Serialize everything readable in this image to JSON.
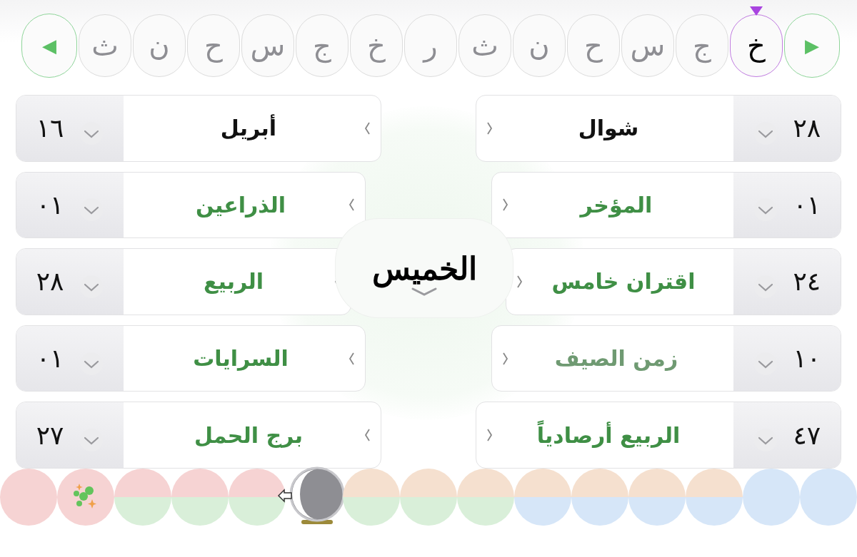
{
  "letter_strip": {
    "next": "▶",
    "previous": "◀",
    "letters": [
      {
        "label": "خ",
        "selected": true
      },
      {
        "label": "ج",
        "selected": false
      },
      {
        "label": "س",
        "selected": false
      },
      {
        "label": "ح",
        "selected": false
      },
      {
        "label": "ن",
        "selected": false
      },
      {
        "label": "ث",
        "selected": false
      },
      {
        "label": "ر",
        "selected": false
      },
      {
        "label": "خ",
        "selected": false
      },
      {
        "label": "ج",
        "selected": false
      },
      {
        "label": "س",
        "selected": false
      },
      {
        "label": "ح",
        "selected": false
      },
      {
        "label": "ن",
        "selected": false
      },
      {
        "label": "ث",
        "selected": false
      }
    ]
  },
  "day": {
    "name": "الخميس"
  },
  "right_column": [
    {
      "number": "٢٨",
      "label": "شوال",
      "color": "#111111"
    },
    {
      "number": "٠١",
      "label": "المؤخر",
      "color": "#3f8f45"
    },
    {
      "number": "٢٤",
      "label": "اقتران خامس",
      "color": "#3f8f45"
    },
    {
      "number": "١٠",
      "label": "زمن الصيف",
      "color": "#6f9a72"
    },
    {
      "number": "٤٧",
      "label": "الربيع أرصادياً",
      "color": "#3f8f45"
    }
  ],
  "left_column": [
    {
      "number": "١٦",
      "label": "أبريل",
      "color": "#111111"
    },
    {
      "number": "٠١",
      "label": "الذراعين",
      "color": "#3f8f45"
    },
    {
      "number": "٢٨",
      "label": "الربيع",
      "color": "#3f8f45"
    },
    {
      "number": "٠١",
      "label": "السرايات",
      "color": "#3f8f45"
    },
    {
      "number": "٢٧",
      "label": "برج الحمل",
      "color": "#3f8f45"
    }
  ],
  "dots": [
    {
      "kind": "plain",
      "halves": [
        {
          "color": "#f6d3d3"
        },
        {
          "color": "#f6d3d3"
        }
      ]
    },
    {
      "kind": "sparkles",
      "halves": [
        {
          "color": "#f6d3d3"
        },
        {
          "color": "#f6d3d3"
        }
      ]
    },
    {
      "kind": "plain",
      "halves": [
        {
          "color": "#f6d3d3"
        },
        {
          "color": "#d9efd9"
        }
      ]
    },
    {
      "kind": "plain",
      "halves": [
        {
          "color": "#f6d3d3"
        },
        {
          "color": "#d9efd9"
        }
      ]
    },
    {
      "kind": "plain",
      "halves": [
        {
          "color": "#f6d3d3"
        },
        {
          "color": "#d9efd9"
        }
      ]
    },
    {
      "kind": "moon"
    },
    {
      "kind": "plain",
      "halves": [
        {
          "color": "#f5e0cf"
        },
        {
          "color": "#d9efd9"
        }
      ]
    },
    {
      "kind": "plain",
      "halves": [
        {
          "color": "#f5e0cf"
        },
        {
          "color": "#d9efd9"
        }
      ]
    },
    {
      "kind": "plain",
      "halves": [
        {
          "color": "#f5e0cf"
        },
        {
          "color": "#d9efd9"
        }
      ]
    },
    {
      "kind": "plain",
      "halves": [
        {
          "color": "#f5e0cf"
        },
        {
          "color": "#d6e6f8"
        }
      ]
    },
    {
      "kind": "plain",
      "halves": [
        {
          "color": "#f5e0cf"
        },
        {
          "color": "#d6e6f8"
        }
      ]
    },
    {
      "kind": "plain",
      "halves": [
        {
          "color": "#f5e0cf"
        },
        {
          "color": "#d6e6f8"
        }
      ]
    },
    {
      "kind": "plain",
      "halves": [
        {
          "color": "#f5e0cf"
        },
        {
          "color": "#d6e6f8"
        }
      ]
    },
    {
      "kind": "plain",
      "halves": [
        {
          "color": "#d6e6f8"
        },
        {
          "color": "#d6e6f8"
        }
      ]
    },
    {
      "kind": "plain",
      "halves": [
        {
          "color": "#d6e6f8"
        },
        {
          "color": "#d6e6f8"
        }
      ]
    }
  ]
}
